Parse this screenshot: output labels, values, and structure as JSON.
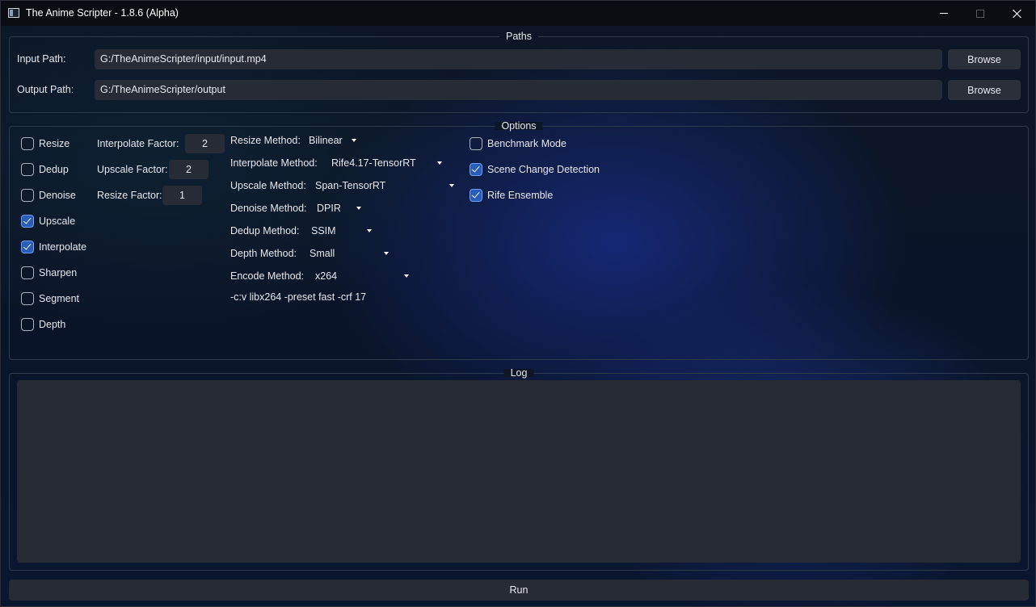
{
  "window": {
    "title": "The Anime Scripter - 1.8.6 (Alpha)"
  },
  "paths": {
    "group_title": "Paths",
    "input_label": "Input Path:",
    "input_value": "G:/TheAnimeScripter/input/input.mp4",
    "output_label": "Output Path:",
    "output_value": "G:/TheAnimeScripter/output",
    "browse_label": "Browse"
  },
  "options": {
    "group_title": "Options",
    "checkboxes": [
      {
        "label": "Resize",
        "checked": false
      },
      {
        "label": "Dedup",
        "checked": false
      },
      {
        "label": "Denoise",
        "checked": false
      },
      {
        "label": "Upscale",
        "checked": true
      },
      {
        "label": "Interpolate",
        "checked": true
      },
      {
        "label": "Sharpen",
        "checked": false
      },
      {
        "label": "Segment",
        "checked": false
      },
      {
        "label": "Depth",
        "checked": false
      }
    ],
    "factors": [
      {
        "label": "Interpolate Factor:",
        "value": "2"
      },
      {
        "label": "Upscale Factor:",
        "value": "2"
      },
      {
        "label": "Resize Factor:",
        "value": "1"
      }
    ],
    "methods": [
      {
        "label": "Resize Method:",
        "value": "Bilinear"
      },
      {
        "label": "Interpolate Method:",
        "value": "Rife4.17-TensorRT"
      },
      {
        "label": "Upscale Method:",
        "value": "Span-TensorRT"
      },
      {
        "label": "Denoise Method:",
        "value": "DPIR"
      },
      {
        "label": "Dedup Method:",
        "value": "SSIM"
      },
      {
        "label": "Depth Method:",
        "value": "Small"
      },
      {
        "label": "Encode Method:",
        "value": "x264"
      }
    ],
    "encode_params": "-c:v libx264 -preset fast -crf 17",
    "extra_checkboxes": [
      {
        "label": "Benchmark Mode",
        "checked": false
      },
      {
        "label": "Scene Change Detection",
        "checked": true
      },
      {
        "label": "Rife Ensemble",
        "checked": true
      }
    ]
  },
  "log": {
    "group_title": "Log",
    "content": ""
  },
  "run": {
    "label": "Run"
  },
  "colors": {
    "checked_fill": "#2a5cb8",
    "field_bg": "#262b35",
    "titlebar_bg": "#0a0d12"
  }
}
